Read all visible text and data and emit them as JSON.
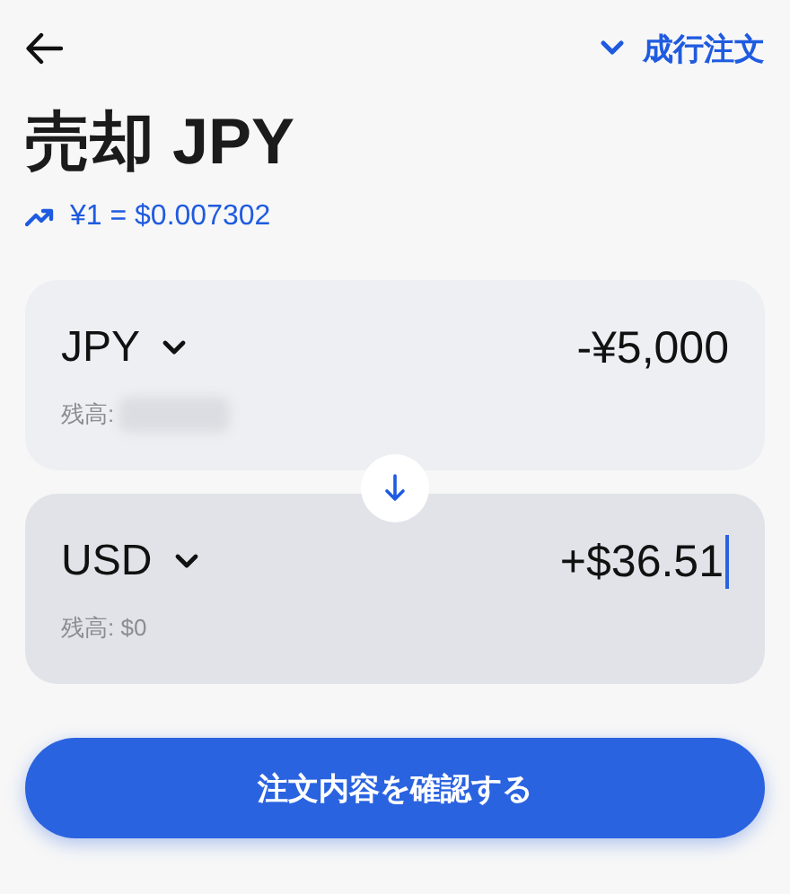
{
  "header": {
    "order_type": "成行注文"
  },
  "title": "売却 JPY",
  "rate": "¥1 = $0.007302",
  "cards": [
    {
      "currency": "JPY",
      "amount": "-¥5,000",
      "balance_label": "残高:",
      "balance_hidden": true,
      "focused": false
    },
    {
      "currency": "USD",
      "amount": "+$36.51",
      "balance_label": "残高: $0",
      "balance_hidden": false,
      "focused": true
    }
  ],
  "confirm_button": "注文内容を確認する"
}
